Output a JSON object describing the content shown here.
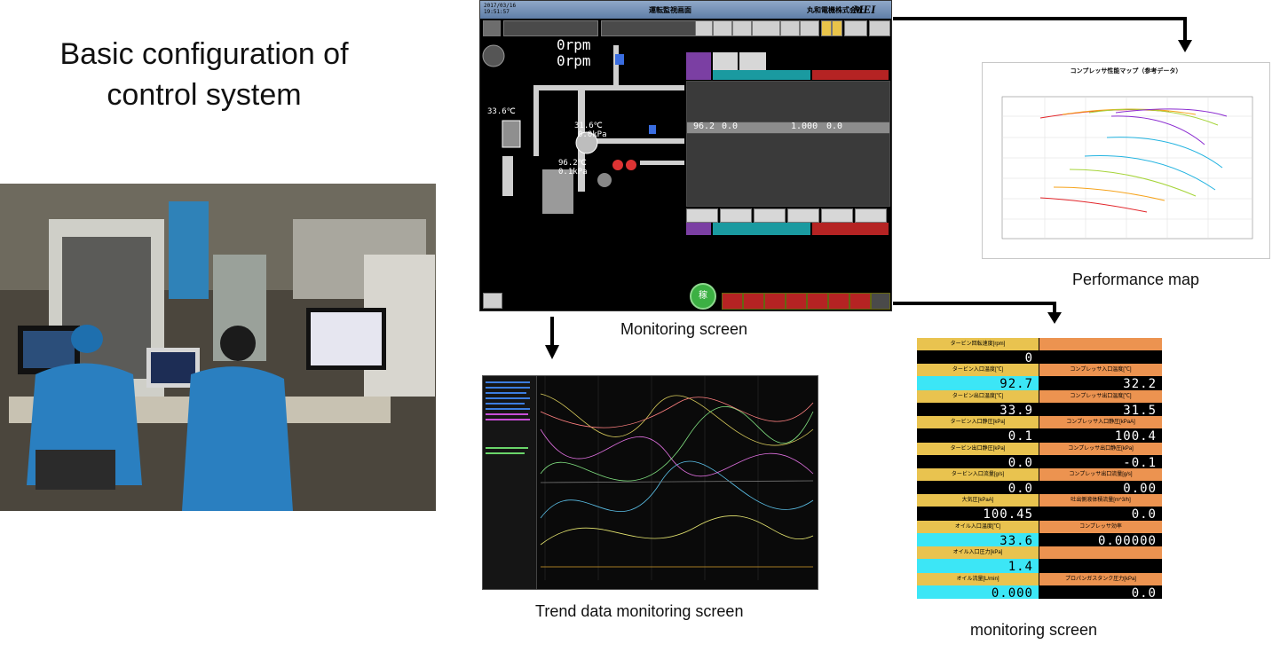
{
  "title": "Basic configuration of control system",
  "captions": {
    "monitoring_main": "Monitoring screen",
    "performance": "Performance map",
    "trend": "Trend data monitoring screen",
    "monitoring_values": "monitoring screen"
  },
  "monitor": {
    "company": "丸和電機株式会社",
    "logo": "MEI",
    "screen_title": "運転監視画面",
    "rpm_top": "0rpm",
    "rpm_bottom": "0rpm",
    "temp1": "33.6℃",
    "temp2": "31.6℃",
    "temp3": "96.2℃",
    "pressure1": "0.0kPa",
    "pressure2": "0.1kPa",
    "val_main": "96.2",
    "val_zero": "0.0",
    "val_one": "1.000",
    "go_label": "稼"
  },
  "perf_map": {
    "title": "コンプレッサ性能マップ（参考データ）"
  },
  "values_table": [
    {
      "left_label": "タービン回転速度[rpm]",
      "left_value": "0",
      "left_style": "dark",
      "right_label": "",
      "right_value": "",
      "right_style": "dark"
    },
    {
      "left_label": "タービン入口温度[℃]",
      "left_value": "92.7",
      "left_style": "cyan",
      "right_label": "コンプレッサ入口温度[℃]",
      "right_value": "32.2",
      "right_style": "dark"
    },
    {
      "left_label": "タービン出口温度[℃]",
      "left_value": "33.9",
      "left_style": "dark",
      "right_label": "コンプレッサ出口温度[℃]",
      "right_value": "31.5",
      "right_style": "dark"
    },
    {
      "left_label": "タービン入口静圧[kPa]",
      "left_value": "0.1",
      "left_style": "dark",
      "right_label": "コンプレッサ入口静圧[kPaA]",
      "right_value": "100.4",
      "right_style": "dark"
    },
    {
      "left_label": "タービン出口静圧[kPa]",
      "left_value": "0.0",
      "left_style": "dark",
      "right_label": "コンプレッサ出口静圧[kPa]",
      "right_value": "-0.1",
      "right_style": "dark"
    },
    {
      "left_label": "タービン入口流量[g/s]",
      "left_value": "0.0",
      "left_style": "dark",
      "right_label": "コンプレッサ出口流量[g/s]",
      "right_value": "0.00",
      "right_style": "dark"
    },
    {
      "left_label": "大気圧[kPaA]",
      "left_value": "100.45",
      "left_style": "dark",
      "right_label": "吐出側液体積流量[m^3/h]",
      "right_value": "0.0",
      "right_style": "dark"
    },
    {
      "left_label": "オイル入口温度[℃]",
      "left_value": "33.6",
      "left_style": "cyan",
      "right_label": "コンプレッサ効率",
      "right_value": "0.00000",
      "right_style": "dark"
    },
    {
      "left_label": "オイル入口圧力[kPa]",
      "left_value": "1.4",
      "left_style": "cyan",
      "right_label": "",
      "right_value": "",
      "right_style": "dark"
    },
    {
      "left_label": "オイル流量[L/min]",
      "left_value": "0.000",
      "left_style": "cyan",
      "right_label": "プロパンガスタンク圧力[kPa]",
      "right_value": "0.0",
      "right_style": "dark"
    }
  ]
}
